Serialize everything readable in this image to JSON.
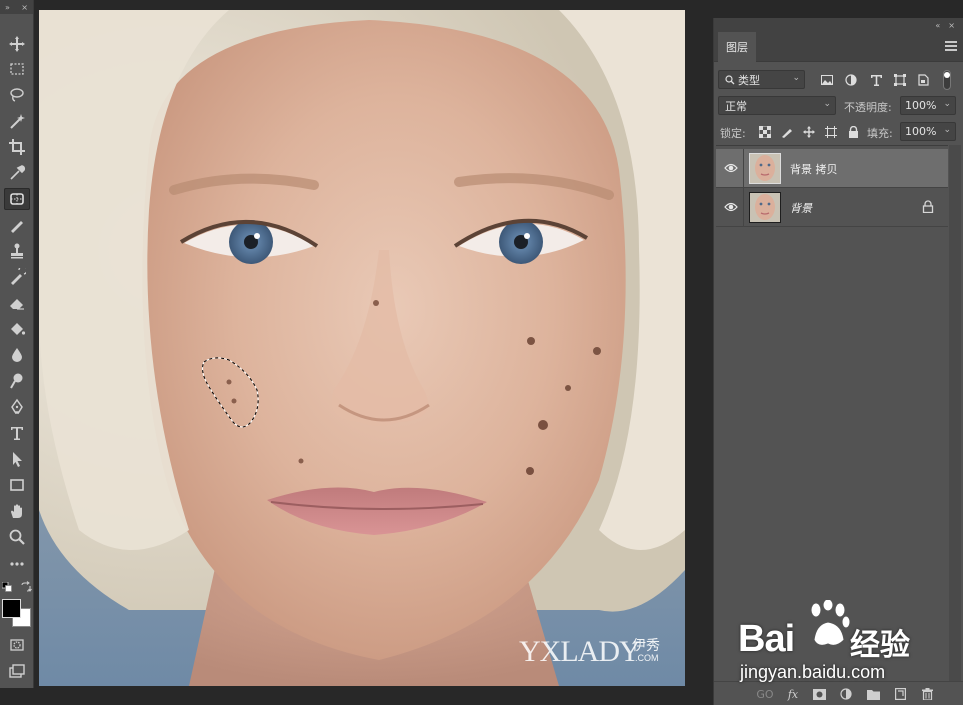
{
  "toolbar": {
    "collapse": "»",
    "close": "×",
    "tools": [
      "move-tool",
      "marquee-tool",
      "lasso-tool",
      "magic-wand-tool",
      "crop-tool",
      "eyedropper-tool",
      "patch-tool",
      "brush-tool",
      "stamp-tool",
      "history-brush-tool",
      "eraser-tool",
      "paint-bucket-tool",
      "blur-tool",
      "dodge-tool",
      "pen-tool",
      "type-tool",
      "path-selection-tool",
      "rectangle-tool",
      "hand-tool",
      "zoom-tool",
      "more-tools"
    ],
    "active_tool": "patch-tool",
    "foreground_color": "#000000",
    "background_color": "#ffffff"
  },
  "panel": {
    "header_collapse": "«",
    "header_close": "×",
    "tab_label": "图层",
    "filter": {
      "label": "类型"
    },
    "blend_mode": {
      "value": "正常"
    },
    "opacity": {
      "label": "不透明度:",
      "value": "100%"
    },
    "lock": {
      "label": "锁定:"
    },
    "fill": {
      "label": "填充:",
      "value": "100%"
    },
    "layers": [
      {
        "name": "背景 拷贝",
        "visible": true,
        "selected": true,
        "locked": false
      },
      {
        "name": "背景",
        "visible": true,
        "selected": false,
        "locked": true
      }
    ],
    "bottom": {
      "link": "GO",
      "fx": "fx"
    }
  },
  "canvas": {
    "watermark_brand": "YXLADY",
    "watermark_cn": "伊秀",
    "watermark_com": ".COM"
  },
  "baidu_watermark": {
    "brand": "Bai",
    "brand_tail": "du",
    "cn": "经验",
    "url": "jingyan.baidu.com"
  }
}
